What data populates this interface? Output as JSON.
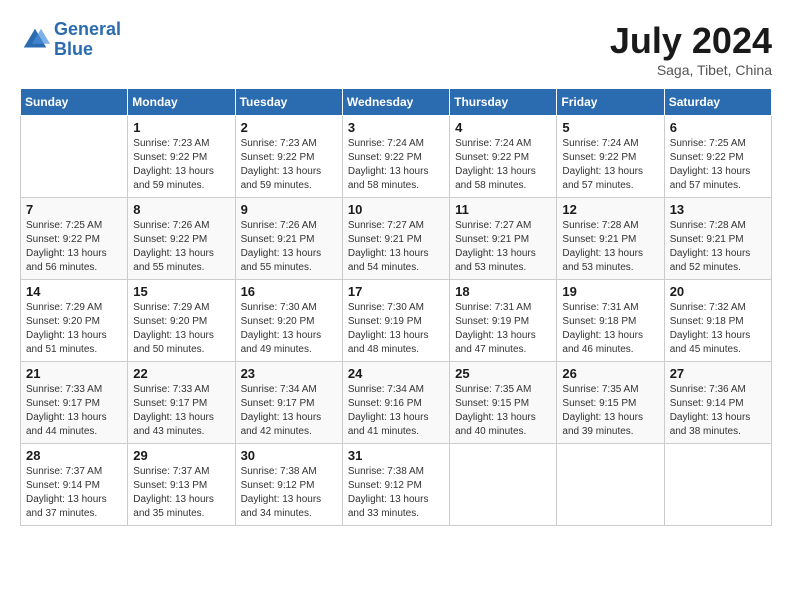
{
  "header": {
    "logo_line1": "General",
    "logo_line2": "Blue",
    "month_title": "July 2024",
    "location": "Saga, Tibet, China"
  },
  "weekdays": [
    "Sunday",
    "Monday",
    "Tuesday",
    "Wednesday",
    "Thursday",
    "Friday",
    "Saturday"
  ],
  "weeks": [
    [
      {
        "day": "",
        "info": ""
      },
      {
        "day": "1",
        "info": "Sunrise: 7:23 AM\nSunset: 9:22 PM\nDaylight: 13 hours\nand 59 minutes."
      },
      {
        "day": "2",
        "info": "Sunrise: 7:23 AM\nSunset: 9:22 PM\nDaylight: 13 hours\nand 59 minutes."
      },
      {
        "day": "3",
        "info": "Sunrise: 7:24 AM\nSunset: 9:22 PM\nDaylight: 13 hours\nand 58 minutes."
      },
      {
        "day": "4",
        "info": "Sunrise: 7:24 AM\nSunset: 9:22 PM\nDaylight: 13 hours\nand 58 minutes."
      },
      {
        "day": "5",
        "info": "Sunrise: 7:24 AM\nSunset: 9:22 PM\nDaylight: 13 hours\nand 57 minutes."
      },
      {
        "day": "6",
        "info": "Sunrise: 7:25 AM\nSunset: 9:22 PM\nDaylight: 13 hours\nand 57 minutes."
      }
    ],
    [
      {
        "day": "7",
        "info": "Sunrise: 7:25 AM\nSunset: 9:22 PM\nDaylight: 13 hours\nand 56 minutes."
      },
      {
        "day": "8",
        "info": "Sunrise: 7:26 AM\nSunset: 9:22 PM\nDaylight: 13 hours\nand 55 minutes."
      },
      {
        "day": "9",
        "info": "Sunrise: 7:26 AM\nSunset: 9:21 PM\nDaylight: 13 hours\nand 55 minutes."
      },
      {
        "day": "10",
        "info": "Sunrise: 7:27 AM\nSunset: 9:21 PM\nDaylight: 13 hours\nand 54 minutes."
      },
      {
        "day": "11",
        "info": "Sunrise: 7:27 AM\nSunset: 9:21 PM\nDaylight: 13 hours\nand 53 minutes."
      },
      {
        "day": "12",
        "info": "Sunrise: 7:28 AM\nSunset: 9:21 PM\nDaylight: 13 hours\nand 53 minutes."
      },
      {
        "day": "13",
        "info": "Sunrise: 7:28 AM\nSunset: 9:21 PM\nDaylight: 13 hours\nand 52 minutes."
      }
    ],
    [
      {
        "day": "14",
        "info": "Sunrise: 7:29 AM\nSunset: 9:20 PM\nDaylight: 13 hours\nand 51 minutes."
      },
      {
        "day": "15",
        "info": "Sunrise: 7:29 AM\nSunset: 9:20 PM\nDaylight: 13 hours\nand 50 minutes."
      },
      {
        "day": "16",
        "info": "Sunrise: 7:30 AM\nSunset: 9:20 PM\nDaylight: 13 hours\nand 49 minutes."
      },
      {
        "day": "17",
        "info": "Sunrise: 7:30 AM\nSunset: 9:19 PM\nDaylight: 13 hours\nand 48 minutes."
      },
      {
        "day": "18",
        "info": "Sunrise: 7:31 AM\nSunset: 9:19 PM\nDaylight: 13 hours\nand 47 minutes."
      },
      {
        "day": "19",
        "info": "Sunrise: 7:31 AM\nSunset: 9:18 PM\nDaylight: 13 hours\nand 46 minutes."
      },
      {
        "day": "20",
        "info": "Sunrise: 7:32 AM\nSunset: 9:18 PM\nDaylight: 13 hours\nand 45 minutes."
      }
    ],
    [
      {
        "day": "21",
        "info": "Sunrise: 7:33 AM\nSunset: 9:17 PM\nDaylight: 13 hours\nand 44 minutes."
      },
      {
        "day": "22",
        "info": "Sunrise: 7:33 AM\nSunset: 9:17 PM\nDaylight: 13 hours\nand 43 minutes."
      },
      {
        "day": "23",
        "info": "Sunrise: 7:34 AM\nSunset: 9:17 PM\nDaylight: 13 hours\nand 42 minutes."
      },
      {
        "day": "24",
        "info": "Sunrise: 7:34 AM\nSunset: 9:16 PM\nDaylight: 13 hours\nand 41 minutes."
      },
      {
        "day": "25",
        "info": "Sunrise: 7:35 AM\nSunset: 9:15 PM\nDaylight: 13 hours\nand 40 minutes."
      },
      {
        "day": "26",
        "info": "Sunrise: 7:35 AM\nSunset: 9:15 PM\nDaylight: 13 hours\nand 39 minutes."
      },
      {
        "day": "27",
        "info": "Sunrise: 7:36 AM\nSunset: 9:14 PM\nDaylight: 13 hours\nand 38 minutes."
      }
    ],
    [
      {
        "day": "28",
        "info": "Sunrise: 7:37 AM\nSunset: 9:14 PM\nDaylight: 13 hours\nand 37 minutes."
      },
      {
        "day": "29",
        "info": "Sunrise: 7:37 AM\nSunset: 9:13 PM\nDaylight: 13 hours\nand 35 minutes."
      },
      {
        "day": "30",
        "info": "Sunrise: 7:38 AM\nSunset: 9:12 PM\nDaylight: 13 hours\nand 34 minutes."
      },
      {
        "day": "31",
        "info": "Sunrise: 7:38 AM\nSunset: 9:12 PM\nDaylight: 13 hours\nand 33 minutes."
      },
      {
        "day": "",
        "info": ""
      },
      {
        "day": "",
        "info": ""
      },
      {
        "day": "",
        "info": ""
      }
    ]
  ]
}
